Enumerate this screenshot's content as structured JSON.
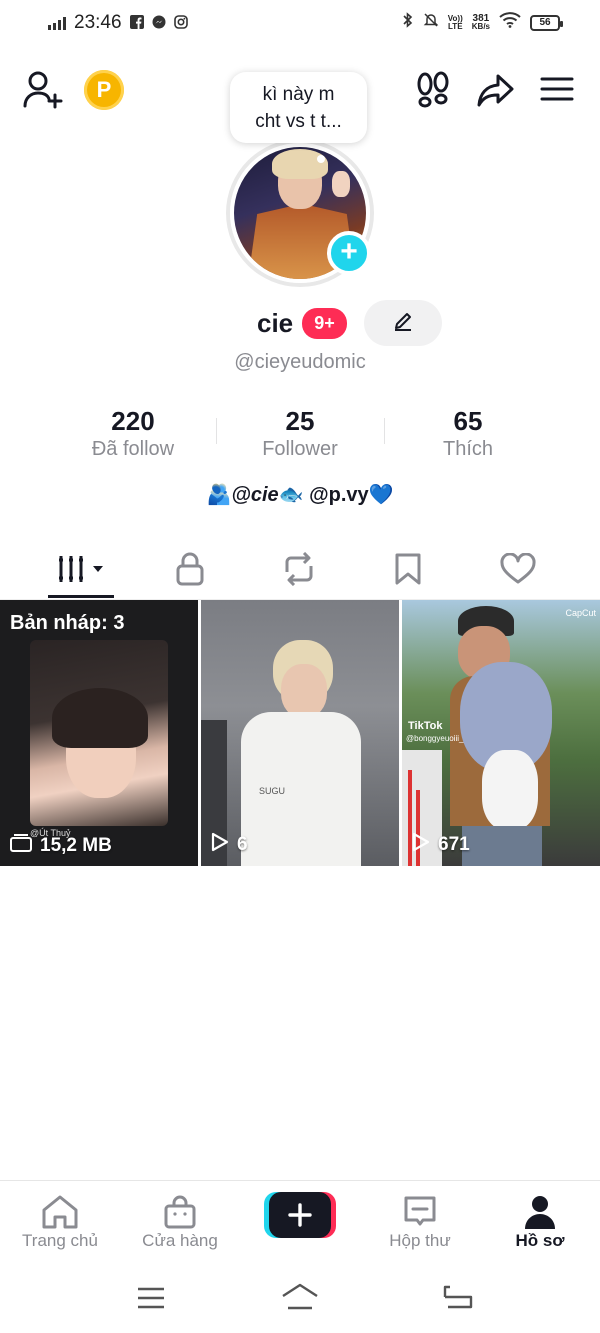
{
  "status_bar": {
    "time": "23:46",
    "network_speed_value": "381",
    "network_speed_unit": "KB/s",
    "volte_top": "Vo))",
    "volte_bottom": "LTE",
    "battery": "56"
  },
  "top_bar": {
    "coin_letter": "P"
  },
  "note": {
    "text_line1": "kì này m",
    "text_line2": "cht vs t t..."
  },
  "profile": {
    "name": "cie",
    "notification_badge": "9+",
    "handle": "@cieyeudomic",
    "stats": [
      {
        "value": "220",
        "label": "Đã follow"
      },
      {
        "value": "25",
        "label": "Follower"
      },
      {
        "value": "65",
        "label": "Thích"
      }
    ],
    "bio_icon": "🫂",
    "bio_mention1": "@cie",
    "bio_fish": "🐟",
    "bio_mention2": "@p.vy",
    "bio_heart": "💙"
  },
  "videos": [
    {
      "type": "draft",
      "title": "Bản nháp: 3",
      "meta": "15,2 MB",
      "watermark": "@Út Thuỷ"
    },
    {
      "type": "video",
      "views": "6",
      "overlay": "SUGU"
    },
    {
      "type": "video",
      "views": "671",
      "watermark_app": "TikTok",
      "watermark_user": "@bonggyeuoiii_",
      "corner": "CapCut"
    }
  ],
  "bottom_nav": [
    {
      "label": "Trang chủ",
      "icon": "home-icon"
    },
    {
      "label": "Cửa hàng",
      "icon": "shop-icon"
    },
    {
      "label": "",
      "icon": "create-plus-icon"
    },
    {
      "label": "Hộp thư",
      "icon": "inbox-icon"
    },
    {
      "label": "Hồ sơ",
      "icon": "profile-icon",
      "active": true
    }
  ],
  "colors": {
    "accent_red": "#fe2c55",
    "accent_cyan": "#20d5ec",
    "text_primary": "#161823",
    "text_secondary": "#8a8b91"
  }
}
